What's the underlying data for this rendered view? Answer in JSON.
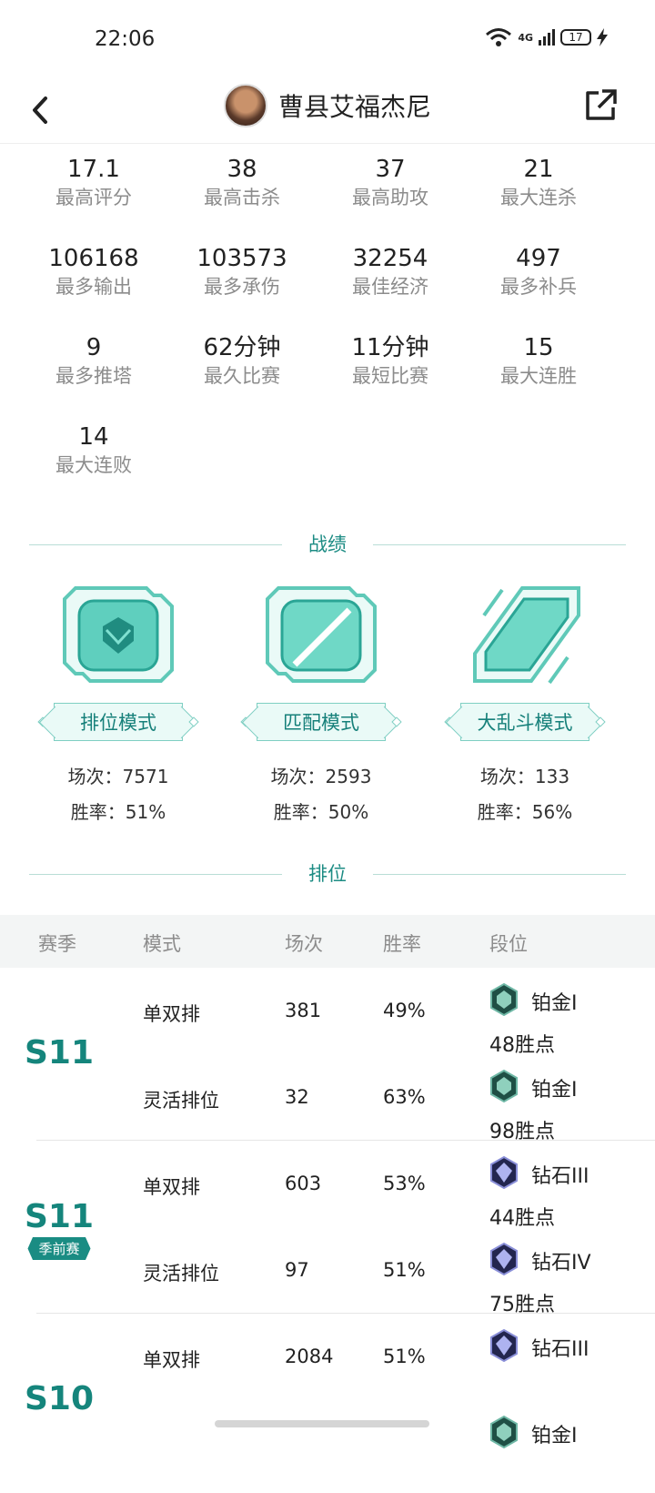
{
  "status": {
    "time": "22:06",
    "network": "4G",
    "battery": "17"
  },
  "header": {
    "title": "曹县艾福杰尼"
  },
  "stats": [
    {
      "value": "17.1",
      "label": "最高评分"
    },
    {
      "value": "38",
      "label": "最高击杀"
    },
    {
      "value": "37",
      "label": "最高助攻"
    },
    {
      "value": "21",
      "label": "最大连杀"
    },
    {
      "value": "106168",
      "label": "最多输出"
    },
    {
      "value": "103573",
      "label": "最多承伤"
    },
    {
      "value": "32254",
      "label": "最佳经济"
    },
    {
      "value": "497",
      "label": "最多补兵"
    },
    {
      "value": "9",
      "label": "最多推塔"
    },
    {
      "value": "62分钟",
      "label": "最久比赛"
    },
    {
      "value": "11分钟",
      "label": "最短比赛"
    },
    {
      "value": "15",
      "label": "最大连胜"
    },
    {
      "value": "14",
      "label": "最大连败"
    }
  ],
  "sections": {
    "record": "战绩",
    "rank": "排位"
  },
  "modes": [
    {
      "name": "排位模式",
      "games": "场次：7571",
      "winrate": "胜率：51%"
    },
    {
      "name": "匹配模式",
      "games": "场次：2593",
      "winrate": "胜率：50%"
    },
    {
      "name": "大乱斗模式",
      "games": "场次：133",
      "winrate": "胜率：56%"
    }
  ],
  "table": {
    "headers": {
      "season": "赛季",
      "mode": "模式",
      "games": "场次",
      "winrate": "胜率",
      "tier": "段位"
    },
    "groups": [
      {
        "season": "S11",
        "tag": "",
        "rows": [
          {
            "mode": "单双排",
            "games": "381",
            "winrate": "49%",
            "tier": "铂金I",
            "points": "48胜点",
            "badge": "platinum"
          },
          {
            "mode": "灵活排位",
            "games": "32",
            "winrate": "63%",
            "tier": "铂金I",
            "points": "98胜点",
            "badge": "platinum"
          }
        ]
      },
      {
        "season": "S11",
        "tag": "季前赛",
        "rows": [
          {
            "mode": "单双排",
            "games": "603",
            "winrate": "53%",
            "tier": "钻石III",
            "points": "44胜点",
            "badge": "diamond"
          },
          {
            "mode": "灵活排位",
            "games": "97",
            "winrate": "51%",
            "tier": "钻石IV",
            "points": "75胜点",
            "badge": "diamond"
          }
        ]
      },
      {
        "season": "S10",
        "tag": "",
        "rows": [
          {
            "mode": "单双排",
            "games": "2084",
            "winrate": "51%",
            "tier": "钻石III",
            "points": "",
            "badge": "diamond"
          },
          {
            "mode": "",
            "games": "",
            "winrate": "",
            "tier": "铂金I",
            "points": "",
            "badge": "platinum"
          }
        ]
      }
    ]
  },
  "colors": {
    "accent": "#1d8c84",
    "platinum": "#2f7d6b",
    "diamond": "#3b3f8c"
  }
}
